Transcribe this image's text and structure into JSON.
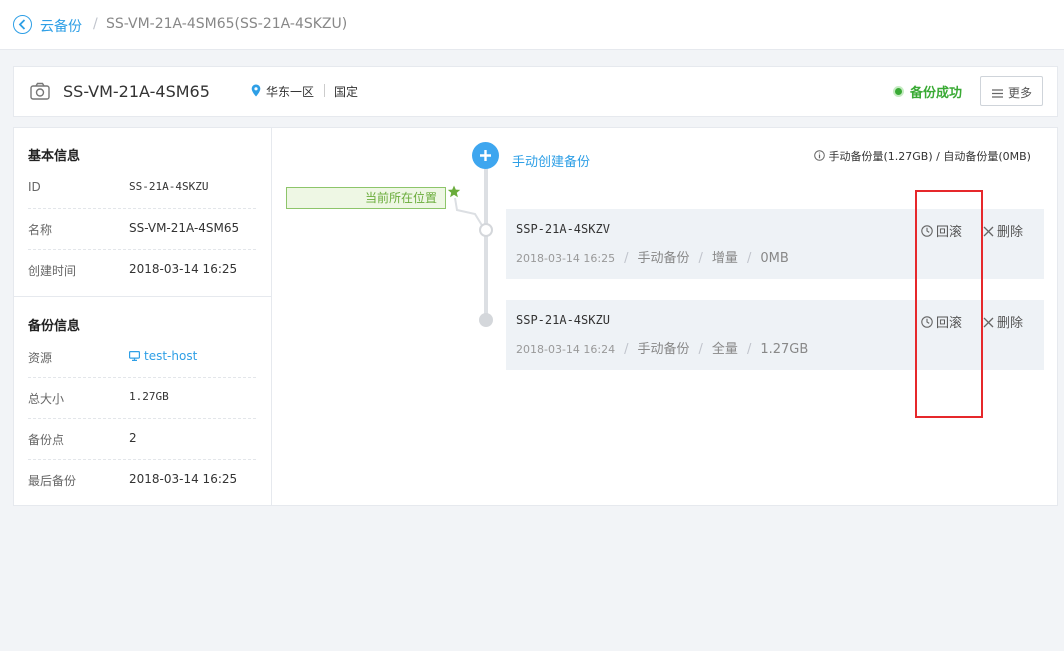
{
  "breadcrumb": {
    "root": "云备份",
    "separator": "/",
    "current": "SS-VM-21A-4SM65(SS-21A-4SKZU)"
  },
  "header": {
    "host_name": "SS-VM-21A-4SM65",
    "region": "华东一区",
    "tag": "国定",
    "status": "备份成功",
    "more_label": "更多"
  },
  "basic_info": {
    "title": "基本信息",
    "rows": [
      {
        "key": "ID",
        "value": "SS-21A-4SKZU"
      },
      {
        "key": "名称",
        "value": "SS-VM-21A-4SM65"
      },
      {
        "key": "创建时间",
        "value": "2018-03-14 16:25"
      }
    ]
  },
  "backup_info": {
    "title": "备份信息",
    "rows": [
      {
        "key": "资源",
        "value": "test-host"
      },
      {
        "key": "总大小",
        "value": "1.27GB"
      },
      {
        "key": "备份点",
        "value": "2"
      },
      {
        "key": "最后备份",
        "value": "2018-03-14 16:25"
      }
    ]
  },
  "timeline": {
    "create_label": "手动创建备份",
    "quota": "手动备份量(1.27GB) / 自动备份量(0MB)",
    "current_position": "当前所在位置",
    "backups": [
      {
        "name": "SSP-21A-4SKZV",
        "time": "2018-03-14 16:25",
        "mode": "手动备份",
        "kind": "增量",
        "size": "0MB",
        "rollback": "回滚",
        "delete": "删除"
      },
      {
        "name": "SSP-21A-4SKZU",
        "time": "2018-03-14 16:24",
        "mode": "手动备份",
        "kind": "全量",
        "size": "1.27GB",
        "rollback": "回滚",
        "delete": "删除"
      }
    ]
  },
  "colors": {
    "accent": "#2e9fe6",
    "success": "#3aaa35",
    "highlight_box": "#e6282b",
    "current_tag": "#6aac3b"
  }
}
